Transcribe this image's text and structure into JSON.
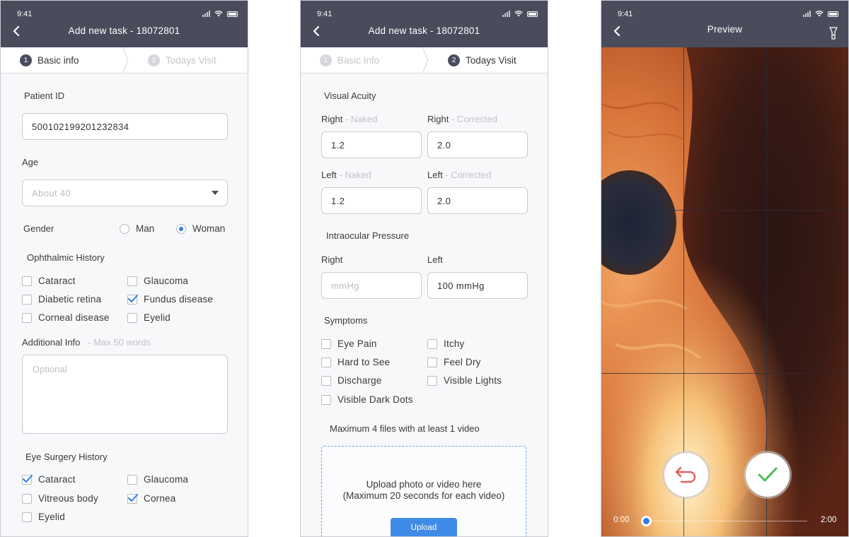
{
  "status_time": "9:41",
  "form": {
    "title": "Add new task - 18072801",
    "steps": [
      {
        "num": "1",
        "label": "Basic info"
      },
      {
        "num": "2",
        "label": "Todays Visit"
      }
    ],
    "steps_alt": [
      {
        "num": "1",
        "label": "Basic Info"
      },
      {
        "num": "2",
        "label": "Todays Visit"
      }
    ]
  },
  "basic": {
    "patient_id_label": "Patient ID",
    "patient_id_value": "500102199201232834",
    "age_label": "Age",
    "age_placeholder": "About 40",
    "gender_label": "Gender",
    "gender_options": [
      "Man",
      "Woman"
    ],
    "gender_selected": "Woman",
    "ophthalmic_label": "Ophthalmic History",
    "ophthalmic_items": [
      {
        "label": "Cataract",
        "checked": false
      },
      {
        "label": "Glaucoma",
        "checked": false
      },
      {
        "label": "Diabetic retina",
        "checked": false
      },
      {
        "label": "Fundus disease",
        "checked": true
      },
      {
        "label": "Corneal disease",
        "checked": false
      },
      {
        "label": "Eyelid",
        "checked": false
      }
    ],
    "additional_label": "Additional Info",
    "additional_hint": "- Max 50 words",
    "additional_placeholder": "Optional",
    "surgery_label": "Eye Surgery History",
    "surgery_items": [
      {
        "label": "Cataract",
        "checked": true
      },
      {
        "label": "Glaucoma",
        "checked": false
      },
      {
        "label": "Vitreous body",
        "checked": false
      },
      {
        "label": "Cornea",
        "checked": true
      },
      {
        "label": "Eyelid",
        "checked": false
      }
    ]
  },
  "visit": {
    "acuity_label": "Visual Acuity",
    "right_naked_label": "Right",
    "right_naked_hint": "- Naked",
    "right_naked_value": "1.2",
    "right_corrected_label": "Right",
    "right_corrected_hint": "- Corrected",
    "right_corrected_value": "2.0",
    "left_naked_label": "Left",
    "left_naked_hint": "- Naked",
    "left_naked_value": "1.2",
    "left_corrected_label": "Left",
    "left_corrected_hint": "- Corrected",
    "left_corrected_value": "2.0",
    "pressure_label": "Intraocular Pressure",
    "pressure_right_label": "Right",
    "pressure_right_placeholder": "mmHg",
    "pressure_left_label": "Left",
    "pressure_left_value": "100 mmHg",
    "symptoms_label": "Symptoms",
    "symptoms": [
      {
        "label": "Eye Pain",
        "checked": false
      },
      {
        "label": "Itchy",
        "checked": false
      },
      {
        "label": "Hard to See",
        "checked": false
      },
      {
        "label": "Feel Dry",
        "checked": false
      },
      {
        "label": "Discharge",
        "checked": false
      },
      {
        "label": "Visible Lights",
        "checked": false
      },
      {
        "label": "Visible Dark Dots",
        "checked": false
      }
    ],
    "files_note": "Maximum 4 files with at least 1 video",
    "upload_line1": "Upload photo or video here",
    "upload_line2": "(Maximum 20 seconds for each video)",
    "upload_button": "Upload"
  },
  "preview": {
    "title": "Preview",
    "time_start": "0:00",
    "time_end": "2:00",
    "progress": 0.0
  },
  "colors": {
    "header": "#4a4c5c",
    "accent": "#2f7de1",
    "upload_button": "#3f8be8",
    "undo": "#e2605e",
    "confirm": "#4cbb5a"
  }
}
